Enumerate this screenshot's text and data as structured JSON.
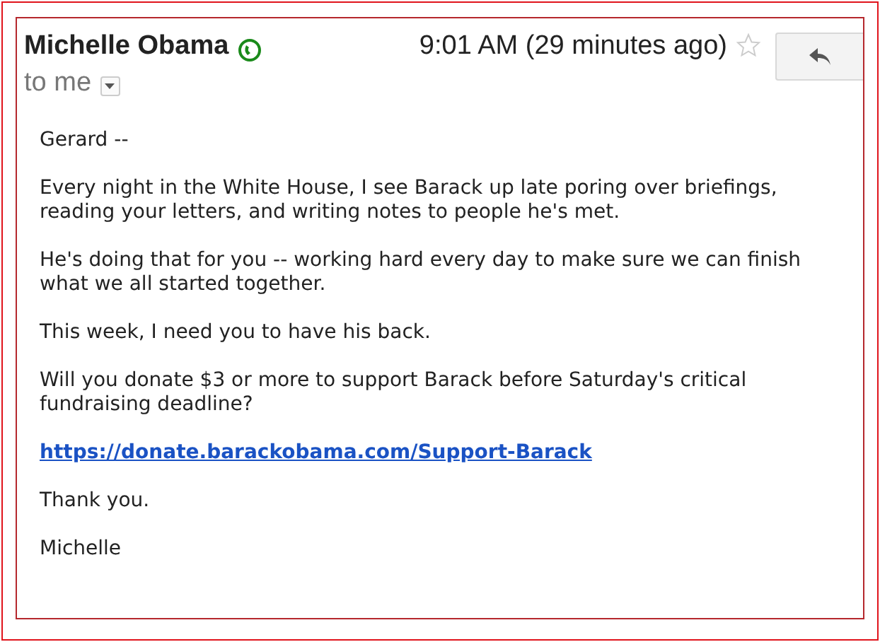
{
  "sender": {
    "name": "Michelle Obama",
    "online": true
  },
  "time": "9:01 AM (29 minutes ago)",
  "starred": false,
  "recipient": "to me",
  "body": [
    {
      "kind": "text",
      "text": "Gerard --"
    },
    {
      "kind": "text",
      "text": "Every night in the White House, I see Barack up late poring over briefings, reading your letters, and writing notes to people he's met."
    },
    {
      "kind": "text",
      "text": "He's doing that for you -- working hard every day to make sure we can finish what we all started together."
    },
    {
      "kind": "text",
      "text": "This week, I need you to have his back."
    },
    {
      "kind": "text",
      "text": "Will you donate $3 or more to support Barack before Saturday's critical fundraising deadline?"
    },
    {
      "kind": "link",
      "text": "https://donate.barackobama.com/Support-Barack"
    },
    {
      "kind": "text",
      "text": "Thank you."
    },
    {
      "kind": "text",
      "text": "Michelle"
    }
  ]
}
